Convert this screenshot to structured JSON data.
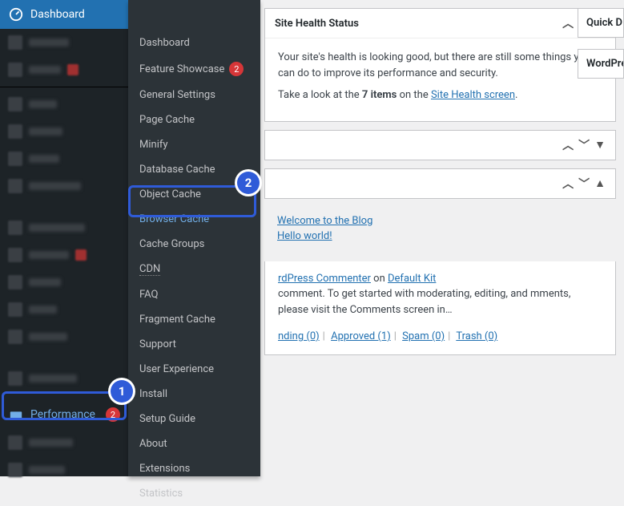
{
  "sidebar": {
    "dashboard": "Dashboard",
    "performance": "Performance",
    "performance_count": "2"
  },
  "submenu": {
    "items": [
      "Dashboard",
      "Feature Showcase",
      "General Settings",
      "Page Cache",
      "Minify",
      "Database Cache",
      "Object Cache",
      "Browser Cache",
      "Cache Groups",
      "CDN",
      "FAQ",
      "Fragment Cache",
      "Support",
      "User Experience",
      "Install",
      "Setup Guide",
      "About",
      "Extensions",
      "Statistics"
    ],
    "feature_count": "2"
  },
  "health": {
    "title": "Site Health Status",
    "body_line1": "Your site's health is looking good, but there are still some things you can do to improve its performance and security.",
    "body_prefix": "Take a look at the ",
    "body_bold": "7 items",
    "body_mid": " on the ",
    "body_link": "Site Health screen",
    "body_end": "."
  },
  "links": {
    "l1": "Welcome to the Blog",
    "l2": "Hello world!"
  },
  "comment": {
    "author": "rdPress Commenter",
    "on": " on ",
    "post": "Default Kit",
    "text": "comment. To get started with moderating, editing, and mments, please visit the Comments screen in…"
  },
  "statuses": {
    "pending": "nding (0)",
    "approved": "Approved (1)",
    "spam": "Spam (0)",
    "trash": "Trash (0)"
  },
  "right": {
    "quick": "Quick D",
    "wp": "WordPre"
  },
  "steps": {
    "s1": "1",
    "s2": "2"
  }
}
